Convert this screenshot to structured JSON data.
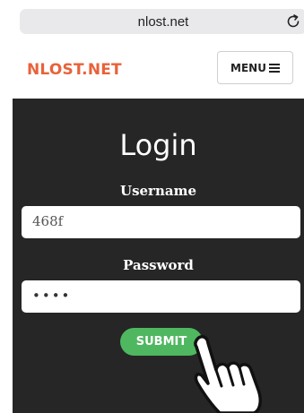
{
  "browser": {
    "url": "nlost.net",
    "reload_icon": "reload-icon"
  },
  "header": {
    "brand": "NLOST.NET",
    "menu_label": "MENU",
    "menu_icon": "hamburger-icon"
  },
  "login": {
    "title": "Login",
    "username_label": "Username",
    "username_value": "468f",
    "password_label": "Password",
    "password_value": "••••",
    "submit_label": "SUBMIT"
  },
  "colors": {
    "brand": "#e8623a",
    "panel": "#262626",
    "submit": "#4fb760"
  },
  "overlay": {
    "icon": "pointing-hand-icon"
  }
}
